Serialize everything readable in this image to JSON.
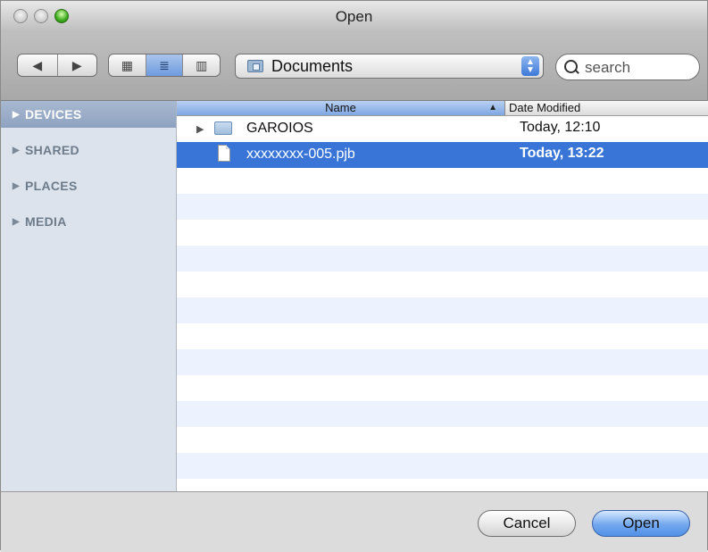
{
  "window": {
    "title": "Open"
  },
  "toolbar": {
    "back_glyph": "◀",
    "forward_glyph": "▶",
    "view_icons": [
      "icon-view-icon",
      "list-view-icon",
      "column-view-icon"
    ],
    "icon_view_glyph": "▦",
    "list_view_glyph": "≣",
    "column_view_glyph": "▥",
    "location": "Documents",
    "search_placeholder": "search"
  },
  "sidebar": {
    "items": [
      {
        "label": "DEVICES",
        "selected": true
      },
      {
        "label": "SHARED",
        "selected": false
      },
      {
        "label": "PLACES",
        "selected": false
      },
      {
        "label": "MEDIA",
        "selected": false
      }
    ]
  },
  "file_list": {
    "columns": {
      "name": "Name",
      "date": "Date Modified",
      "sort": "ascending"
    },
    "rows": [
      {
        "type": "folder",
        "name": "GAROIOS",
        "date": "Today, 12:10",
        "selected": false
      },
      {
        "type": "file",
        "name": "xxxxxxxx-005.pjb",
        "date": "Today, 13:22",
        "selected": true
      }
    ]
  },
  "buttons": {
    "cancel": "Cancel",
    "open": "Open"
  },
  "colors": {
    "selection": "#3875d7",
    "default_button": "#5291e6",
    "sidebar_bg": "#dde3ec"
  }
}
